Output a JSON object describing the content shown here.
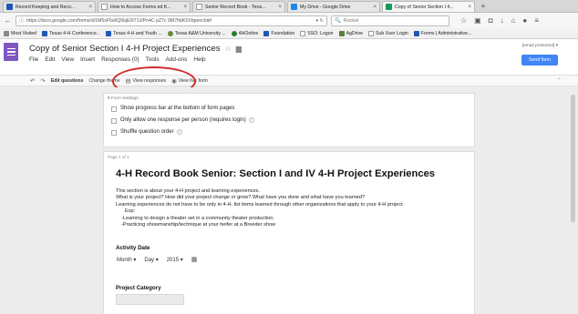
{
  "browser": {
    "tabs": [
      {
        "label": "Record Keeping and Reco...",
        "color": "#1f57b5"
      },
      {
        "label": "How to Access Forms ed K...",
        "color": "#cccccc"
      },
      {
        "label": "Senior Record Book - Texa...",
        "color": "#cccccc"
      },
      {
        "label": "My Drive - Google Drive",
        "color": "#1e88e5"
      },
      {
        "label": "Copy of Senior Section I 4...",
        "color": "#0f9d58"
      }
    ],
    "url": "https://docs.google.com/forms/d/1M5xF5s6Q5kjE0iT1J/Pn4C pZ7c 9M7hbK5Xbpencbit#",
    "search_placeholder": "Rocket",
    "bookmarks": [
      "Most Visited",
      "Texas 4-H Conference...",
      "Texas 4-H and Youth ...",
      "Texas A&M University ...",
      "4HOnline",
      "Foundation",
      "SSO: Logon",
      "AgDrive",
      "Sub User Login",
      "Forms | Administrative..."
    ]
  },
  "header": {
    "title": "Copy of Senior  Section I 4-H Project Experiences",
    "menu": [
      "File",
      "Edit",
      "View",
      "Insert",
      "Responses (0)",
      "Tools",
      "Add-ons",
      "Help"
    ],
    "account": "[email protected] ▾",
    "send_label": "Send form"
  },
  "toolbar": {
    "edit_questions": "Edit questions",
    "change_theme": "Change theme",
    "view_responses": "View responses",
    "view_live": "View live form"
  },
  "settings": {
    "title": "▾ Form Settings",
    "options": [
      "Show progress bar at the bottom of form pages",
      "Only allow one response per person (requires login)",
      "Shuffle question order"
    ]
  },
  "form": {
    "page_label": "Page 1 of 1",
    "title": "4-H Record Book Senior: Section I and IV 4-H Project Experiences",
    "description": [
      "This section is about your 4-H project and learning experiences.",
      "What is your project? How did your project change or grow? What have you done and what have you learned?",
      "Learning experiences do not have to be only in 4-H. list items learned through other organizations that apply to your 4-H project.",
      "Exp:",
      "-Learning to design a theater set in a community theater production.",
      "-Practicing showmanship/technique at your heifer at a Breeder show"
    ],
    "activity_date_label": "Activity Date",
    "date_parts": [
      "Month ▾",
      "Day ▾",
      "2015 ▾"
    ],
    "category_label": "Project Category"
  },
  "colors": {
    "forms_purple": "#7e57c2",
    "send_blue": "#4285f4",
    "annotation_red": "#d12a2a"
  }
}
